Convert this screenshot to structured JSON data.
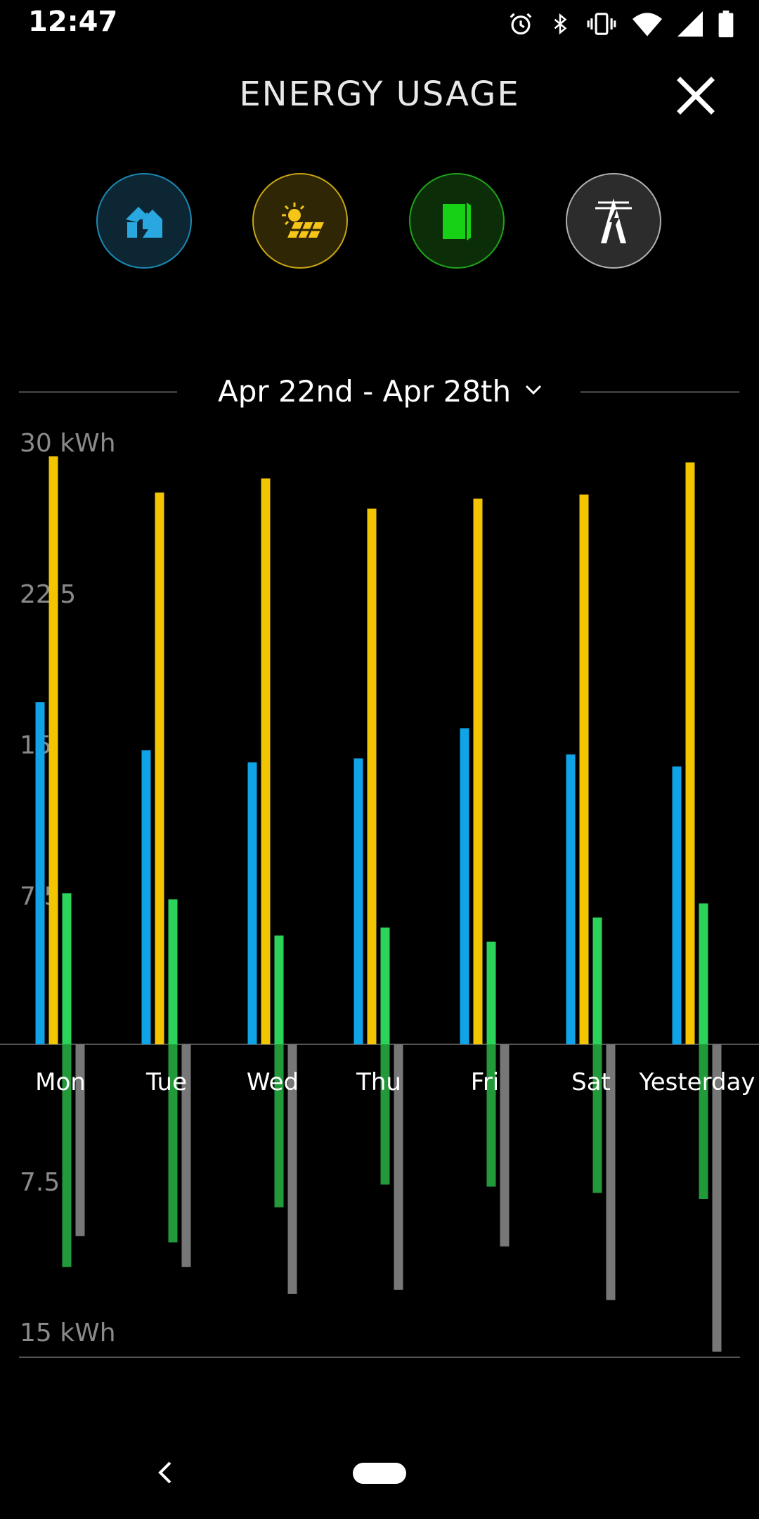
{
  "status_bar": {
    "time": "12:47",
    "icons": [
      "alarm-icon",
      "bluetooth-icon",
      "vibrate-icon",
      "wifi-icon",
      "signal-icon",
      "battery-icon"
    ]
  },
  "header": {
    "title": "ENERGY USAGE",
    "close_icon": "close-icon"
  },
  "filters": [
    {
      "name": "home",
      "icon": "home-icon",
      "color": "#29a8e0"
    },
    {
      "name": "solar",
      "icon": "solar-panel-icon",
      "color": "#f5c518"
    },
    {
      "name": "battery",
      "icon": "battery-pack-icon",
      "color": "#16d116"
    },
    {
      "name": "grid",
      "icon": "power-tower-icon",
      "color": "#ffffff"
    }
  ],
  "date_range": {
    "label": "Apr 22nd - Apr 28th",
    "icon": "chevron-down-icon"
  },
  "chart_data": {
    "type": "bar",
    "categories": [
      "Mon",
      "Tue",
      "Wed",
      "Thu",
      "Fri",
      "Sat",
      "Yesterday"
    ],
    "upper_ticks": [
      "30 kWh",
      "22.5",
      "15",
      "7.5"
    ],
    "lower_ticks": [
      "7.5",
      "15 kWh"
    ],
    "upper_ylim": [
      0,
      30
    ],
    "lower_ylim": [
      0,
      15
    ],
    "series": [
      {
        "key": "home",
        "color": "#10a4e6",
        "direction": "up",
        "values": [
          17.0,
          14.6,
          14.0,
          14.2,
          15.7,
          14.4,
          13.8
        ]
      },
      {
        "key": "solar",
        "color": "#f2c500",
        "direction": "up",
        "values": [
          29.2,
          27.4,
          28.1,
          26.6,
          27.1,
          27.3,
          28.9
        ]
      },
      {
        "key": "battery_charge",
        "color": "#2bd35a",
        "direction": "up",
        "values": [
          7.5,
          7.2,
          5.4,
          5.8,
          5.1,
          6.3,
          7.0
        ]
      },
      {
        "key": "battery_discharge",
        "color": "#239a3a",
        "direction": "down",
        "values": [
          10.8,
          9.6,
          7.9,
          6.8,
          6.9,
          7.2,
          7.5
        ]
      },
      {
        "key": "grid",
        "color": "#777777",
        "direction": "down",
        "values": [
          9.3,
          10.8,
          12.1,
          11.9,
          9.8,
          12.4,
          14.9
        ]
      }
    ]
  },
  "nav": {
    "back_icon": "back-chevron-icon",
    "home_pill": "home-pill"
  }
}
